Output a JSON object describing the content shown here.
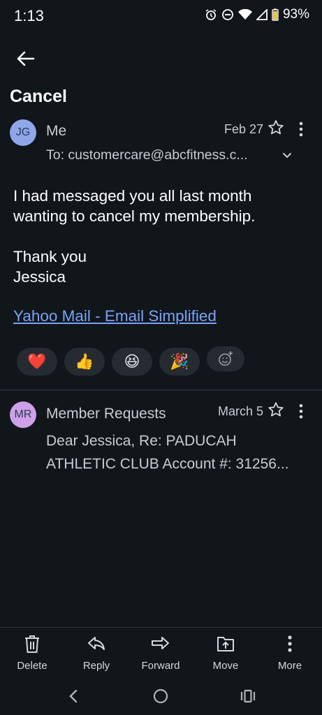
{
  "status_bar": {
    "time": "1:13",
    "battery": "93%",
    "icons": [
      "alarm-icon",
      "dnd-icon",
      "wifi-icon",
      "signal-icon",
      "battery-icon"
    ]
  },
  "subject": "Cancel",
  "message1": {
    "avatar_initials": "JG",
    "sender": "Me",
    "date": "Feb 27",
    "to": "To: customercare@abcfitness.c...",
    "body": [
      "I had messaged you all last month",
      "wanting to cancel my membership.",
      "",
      "Thank you",
      "Jessica"
    ],
    "link": "Yahoo Mail - Email Simplified",
    "reactions": [
      "❤️",
      "👍",
      "😆",
      "🎉"
    ]
  },
  "message2": {
    "avatar_initials": "MR",
    "sender": "Member Requests",
    "date": "March 5",
    "snippet_line1": "Dear Jessica, Re: PADUCAH",
    "snippet_line2": "ATHLETIC CLUB Account #: 31256..."
  },
  "actions": {
    "delete": "Delete",
    "reply": "Reply",
    "forward": "Forward",
    "move": "Move",
    "more": "More"
  },
  "colors": {
    "background": "#11161b",
    "link": "#7aa2f7",
    "avatar_jg": "#8fa6e9",
    "avatar_mr": "#cfa0ea"
  }
}
